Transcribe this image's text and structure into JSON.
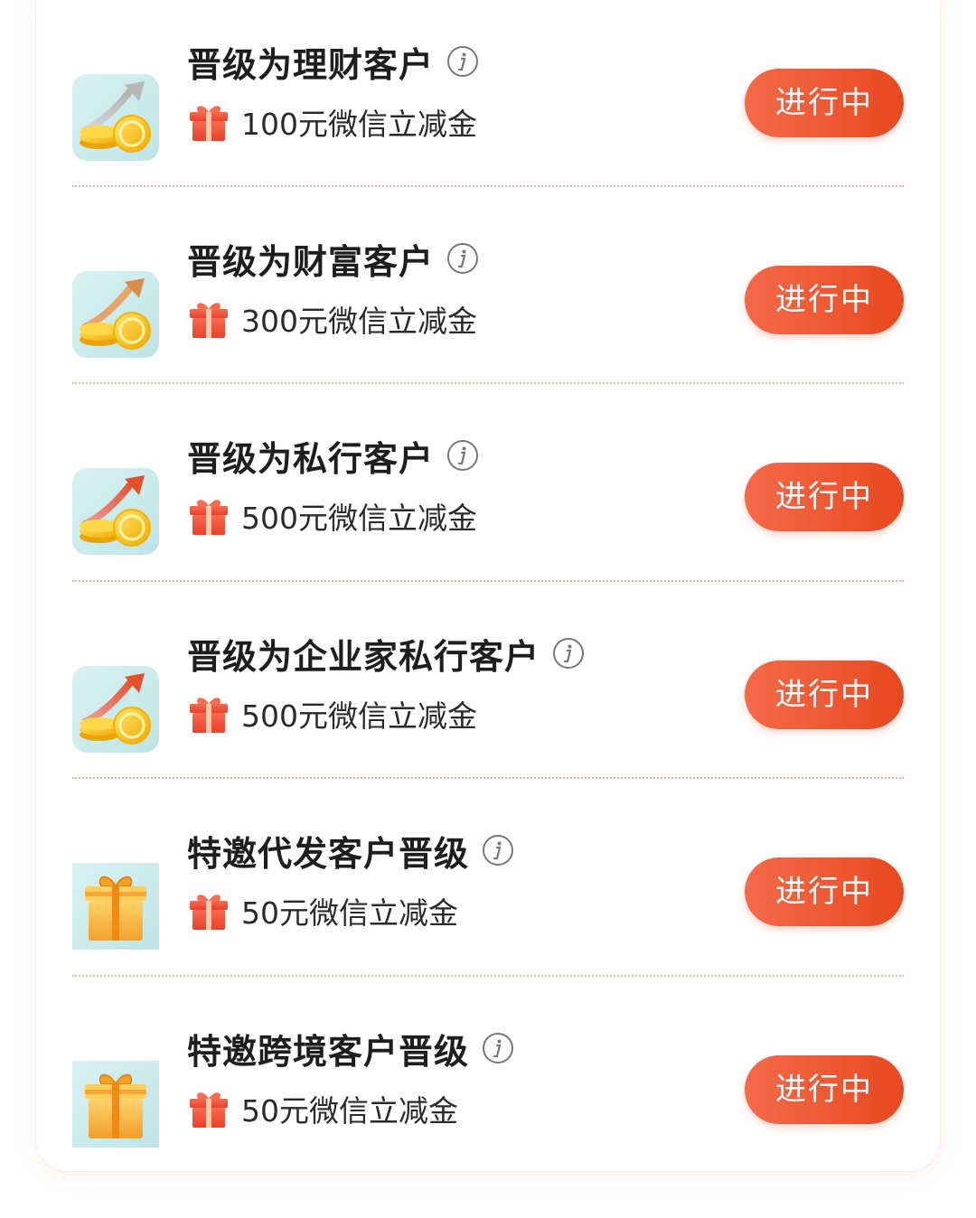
{
  "tasks": [
    {
      "title": "晋级为理财客户",
      "reward": "100元微信立减金",
      "status": "进行中",
      "icon": "coins-arrow-icon"
    },
    {
      "title": "晋级为财富客户",
      "reward": "300元微信立减金",
      "status": "进行中",
      "icon": "coins-arrow-icon"
    },
    {
      "title": "晋级为私行客户",
      "reward": "500元微信立减金",
      "status": "进行中",
      "icon": "coins-arrow-icon"
    },
    {
      "title": "晋级为企业家私行客户",
      "reward": "500元微信立减金",
      "status": "进行中",
      "icon": "coins-arrow-icon"
    },
    {
      "title": "特邀代发客户晋级",
      "reward": "50元微信立减金",
      "status": "进行中",
      "icon": "gift-box-icon"
    },
    {
      "title": "特邀跨境客户晋级",
      "reward": "50元微信立减金",
      "status": "进行中",
      "icon": "gift-box-icon"
    }
  ],
  "colors": {
    "accent": "#ea4f27",
    "divider": "#f3b3a6",
    "gift": "#f0543c"
  }
}
